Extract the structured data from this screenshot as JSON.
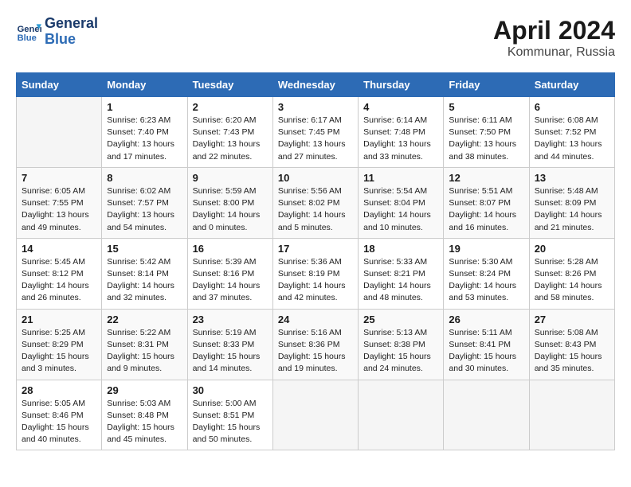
{
  "header": {
    "logo_line1": "General",
    "logo_line2": "Blue",
    "title": "April 2024",
    "subtitle": "Kommunar, Russia"
  },
  "weekdays": [
    "Sunday",
    "Monday",
    "Tuesday",
    "Wednesday",
    "Thursday",
    "Friday",
    "Saturday"
  ],
  "weeks": [
    [
      {
        "day": "",
        "info": ""
      },
      {
        "day": "1",
        "info": "Sunrise: 6:23 AM\nSunset: 7:40 PM\nDaylight: 13 hours\nand 17 minutes."
      },
      {
        "day": "2",
        "info": "Sunrise: 6:20 AM\nSunset: 7:43 PM\nDaylight: 13 hours\nand 22 minutes."
      },
      {
        "day": "3",
        "info": "Sunrise: 6:17 AM\nSunset: 7:45 PM\nDaylight: 13 hours\nand 27 minutes."
      },
      {
        "day": "4",
        "info": "Sunrise: 6:14 AM\nSunset: 7:48 PM\nDaylight: 13 hours\nand 33 minutes."
      },
      {
        "day": "5",
        "info": "Sunrise: 6:11 AM\nSunset: 7:50 PM\nDaylight: 13 hours\nand 38 minutes."
      },
      {
        "day": "6",
        "info": "Sunrise: 6:08 AM\nSunset: 7:52 PM\nDaylight: 13 hours\nand 44 minutes."
      }
    ],
    [
      {
        "day": "7",
        "info": "Sunrise: 6:05 AM\nSunset: 7:55 PM\nDaylight: 13 hours\nand 49 minutes."
      },
      {
        "day": "8",
        "info": "Sunrise: 6:02 AM\nSunset: 7:57 PM\nDaylight: 13 hours\nand 54 minutes."
      },
      {
        "day": "9",
        "info": "Sunrise: 5:59 AM\nSunset: 8:00 PM\nDaylight: 14 hours\nand 0 minutes."
      },
      {
        "day": "10",
        "info": "Sunrise: 5:56 AM\nSunset: 8:02 PM\nDaylight: 14 hours\nand 5 minutes."
      },
      {
        "day": "11",
        "info": "Sunrise: 5:54 AM\nSunset: 8:04 PM\nDaylight: 14 hours\nand 10 minutes."
      },
      {
        "day": "12",
        "info": "Sunrise: 5:51 AM\nSunset: 8:07 PM\nDaylight: 14 hours\nand 16 minutes."
      },
      {
        "day": "13",
        "info": "Sunrise: 5:48 AM\nSunset: 8:09 PM\nDaylight: 14 hours\nand 21 minutes."
      }
    ],
    [
      {
        "day": "14",
        "info": "Sunrise: 5:45 AM\nSunset: 8:12 PM\nDaylight: 14 hours\nand 26 minutes."
      },
      {
        "day": "15",
        "info": "Sunrise: 5:42 AM\nSunset: 8:14 PM\nDaylight: 14 hours\nand 32 minutes."
      },
      {
        "day": "16",
        "info": "Sunrise: 5:39 AM\nSunset: 8:16 PM\nDaylight: 14 hours\nand 37 minutes."
      },
      {
        "day": "17",
        "info": "Sunrise: 5:36 AM\nSunset: 8:19 PM\nDaylight: 14 hours\nand 42 minutes."
      },
      {
        "day": "18",
        "info": "Sunrise: 5:33 AM\nSunset: 8:21 PM\nDaylight: 14 hours\nand 48 minutes."
      },
      {
        "day": "19",
        "info": "Sunrise: 5:30 AM\nSunset: 8:24 PM\nDaylight: 14 hours\nand 53 minutes."
      },
      {
        "day": "20",
        "info": "Sunrise: 5:28 AM\nSunset: 8:26 PM\nDaylight: 14 hours\nand 58 minutes."
      }
    ],
    [
      {
        "day": "21",
        "info": "Sunrise: 5:25 AM\nSunset: 8:29 PM\nDaylight: 15 hours\nand 3 minutes."
      },
      {
        "day": "22",
        "info": "Sunrise: 5:22 AM\nSunset: 8:31 PM\nDaylight: 15 hours\nand 9 minutes."
      },
      {
        "day": "23",
        "info": "Sunrise: 5:19 AM\nSunset: 8:33 PM\nDaylight: 15 hours\nand 14 minutes."
      },
      {
        "day": "24",
        "info": "Sunrise: 5:16 AM\nSunset: 8:36 PM\nDaylight: 15 hours\nand 19 minutes."
      },
      {
        "day": "25",
        "info": "Sunrise: 5:13 AM\nSunset: 8:38 PM\nDaylight: 15 hours\nand 24 minutes."
      },
      {
        "day": "26",
        "info": "Sunrise: 5:11 AM\nSunset: 8:41 PM\nDaylight: 15 hours\nand 30 minutes."
      },
      {
        "day": "27",
        "info": "Sunrise: 5:08 AM\nSunset: 8:43 PM\nDaylight: 15 hours\nand 35 minutes."
      }
    ],
    [
      {
        "day": "28",
        "info": "Sunrise: 5:05 AM\nSunset: 8:46 PM\nDaylight: 15 hours\nand 40 minutes."
      },
      {
        "day": "29",
        "info": "Sunrise: 5:03 AM\nSunset: 8:48 PM\nDaylight: 15 hours\nand 45 minutes."
      },
      {
        "day": "30",
        "info": "Sunrise: 5:00 AM\nSunset: 8:51 PM\nDaylight: 15 hours\nand 50 minutes."
      },
      {
        "day": "",
        "info": ""
      },
      {
        "day": "",
        "info": ""
      },
      {
        "day": "",
        "info": ""
      },
      {
        "day": "",
        "info": ""
      }
    ]
  ]
}
